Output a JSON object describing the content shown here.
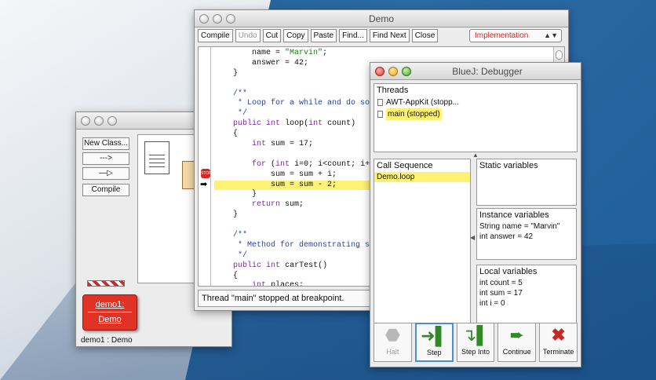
{
  "main_window": {
    "side_buttons": [
      "New Class...",
      "--->",
      "—▷",
      "Compile"
    ],
    "object": {
      "name": "demo1:",
      "class": "Demo"
    },
    "status": "demo1 : Demo"
  },
  "editor": {
    "title": "Demo",
    "toolbar": [
      {
        "label": "Compile",
        "enabled": true
      },
      {
        "label": "Undo",
        "enabled": false
      },
      {
        "label": "Cut",
        "enabled": true
      },
      {
        "label": "Copy",
        "enabled": true
      },
      {
        "label": "Paste",
        "enabled": true
      },
      {
        "label": "Find...",
        "enabled": true
      },
      {
        "label": "Find Next",
        "enabled": true
      },
      {
        "label": "Close",
        "enabled": true
      }
    ],
    "view_select": "Implementation",
    "code": [
      "        name = \"Marvin\";",
      "        answer = 42;",
      "    }",
      "",
      "    /**",
      "     * Loop for a while and do some m",
      "     */",
      "    public int loop(int count)",
      "    {",
      "        int sum = 17;",
      "",
      "        for (int i=0; i<count; i++) {",
      "            sum = sum + i;",
      "            sum = sum - 2;",
      "        }",
      "        return sum;",
      "    }",
      "",
      "    /**",
      "     * Method for demonstrating singl",
      "     */",
      "    public int carTest()",
      "    {",
      "        int places;"
    ],
    "highlight_line": 13,
    "status": "Thread \"main\" stopped at breakpoint."
  },
  "debugger": {
    "title": "BlueJ:  Debugger",
    "threads_title": "Threads",
    "threads": [
      "AWT-AppKit (stopp...",
      "main (stopped)"
    ],
    "call_sequence_title": "Call Sequence",
    "call_sequence": [
      "Demo.loop"
    ],
    "static_title": "Static variables",
    "instance_title": "Instance variables",
    "instance_vars": [
      "String name = \"Marvin\"",
      "int answer = 42"
    ],
    "local_title": "Local variables",
    "local_vars": [
      "int count = 5",
      "int sum = 17",
      "int i = 0"
    ],
    "controls": [
      {
        "label": "Halt",
        "icon": "halt-icon",
        "enabled": false
      },
      {
        "label": "Step",
        "icon": "step-icon",
        "enabled": true
      },
      {
        "label": "Step Into",
        "icon": "step-into-icon",
        "enabled": true
      },
      {
        "label": "Continue",
        "icon": "continue-icon",
        "enabled": true
      },
      {
        "label": "Terminate",
        "icon": "terminate-icon",
        "enabled": true
      }
    ]
  }
}
